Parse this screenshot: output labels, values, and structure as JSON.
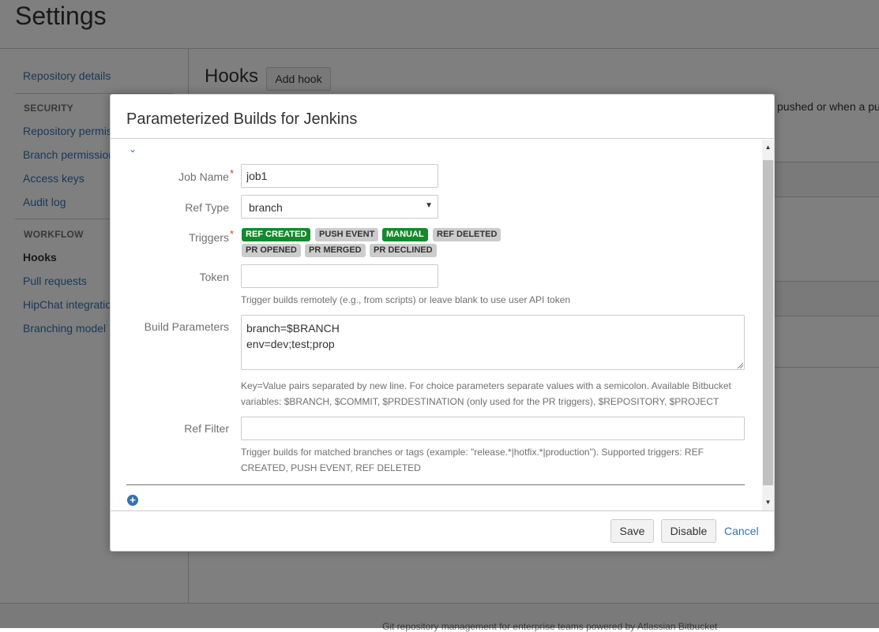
{
  "page": {
    "title": "Settings",
    "main_title": "Hooks",
    "add_hook_label": "Add hook",
    "bg_description_fragment": "pushed or when a pu",
    "footer_text": "Git repository management for enterprise teams powered by Atlassian Bitbucket"
  },
  "sidebar": {
    "repository_details": "Repository details",
    "security_heading": "SECURITY",
    "repository_permissions": "Repository permissions",
    "branch_permissions": "Branch permissions",
    "access_keys": "Access keys",
    "audit_log": "Audit log",
    "workflow_heading": "WORKFLOW",
    "hooks": "Hooks",
    "pull_requests": "Pull requests",
    "hipchat": "HipChat integration",
    "branching_model": "Branching model"
  },
  "dialog": {
    "title": "Parameterized Builds for Jenkins",
    "job_name_label": "Job Name",
    "job_name_value": "job1",
    "ref_type_label": "Ref Type",
    "ref_type_value": "branch",
    "triggers_label": "Triggers",
    "triggers": [
      {
        "label": "REF CREATED",
        "active": true
      },
      {
        "label": "PUSH EVENT",
        "active": false
      },
      {
        "label": "MANUAL",
        "active": true
      },
      {
        "label": "REF DELETED",
        "active": false
      },
      {
        "label": "PR OPENED",
        "active": false
      },
      {
        "label": "PR MERGED",
        "active": false
      },
      {
        "label": "PR DECLINED",
        "active": false
      }
    ],
    "token_label": "Token",
    "token_value": "",
    "token_help": "Trigger builds remotely (e.g., from scripts) or leave blank to use user API token",
    "build_params_label": "Build Parameters",
    "build_params_lines": [
      "branch=$BRANCH",
      "env=dev;test;prop"
    ],
    "build_params_help_1": "Key=Value pairs separated by new line. For choice parameters separate values with a semicolon. Available Bitbucket",
    "build_params_help_2": "variables: $BRANCH, $COMMIT, $PRDESTINATION (only used for the PR triggers), $REPOSITORY, $PROJECT",
    "ref_filter_label": "Ref Filter",
    "ref_filter_value": "",
    "ref_filter_help_1": "Trigger builds for matched branches or tags (example: \"release.*|hotfix.*|production\"). Supported triggers: REF",
    "ref_filter_help_2": "CREATED, PUSH EVENT, REF DELETED",
    "save_label": "Save",
    "disable_label": "Disable",
    "cancel_label": "Cancel"
  },
  "colors": {
    "link": "#3572b0",
    "lozenge_active": "#14892c",
    "lozenge_inactive": "#cccccc",
    "required": "#d04437"
  },
  "icons": {
    "collapse": "chevron-down-icon",
    "add": "plus-circle-icon",
    "select_arrow": "caret-down-icon"
  }
}
